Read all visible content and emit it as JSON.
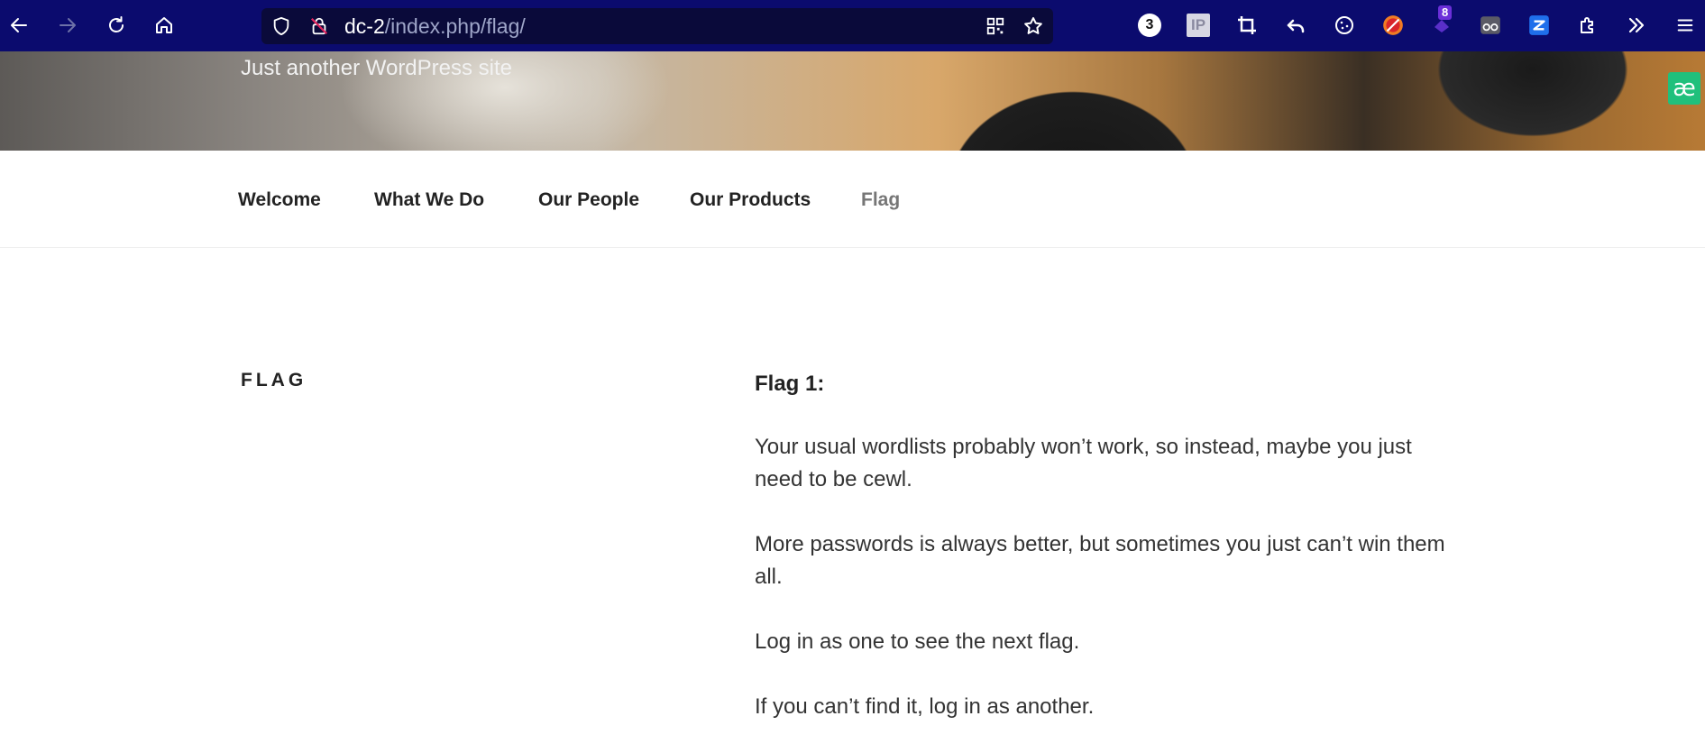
{
  "browser": {
    "url_host": "dc-2",
    "url_path": "/index.php/flag/",
    "extensions": {
      "counter_badge": "3",
      "ip_label": "IP",
      "notification_count": "8"
    }
  },
  "site": {
    "tagline": "Just another WordPress site",
    "extension_label": "æ"
  },
  "nav": {
    "items": [
      {
        "label": "Welcome"
      },
      {
        "label": "What We Do"
      },
      {
        "label": "Our People"
      },
      {
        "label": "Our Products"
      },
      {
        "label": "Flag"
      }
    ],
    "current": "Flag"
  },
  "page": {
    "title": "FLAG",
    "content": {
      "heading": "Flag 1:",
      "paragraphs": [
        "Your usual wordlists probably won’t work, so instead, maybe you just need to be cewl.",
        "More passwords is always better, but sometimes you just can’t win them all.",
        "Log in as one to see the next flag.",
        "If you can’t find it, log in as another."
      ]
    }
  }
}
